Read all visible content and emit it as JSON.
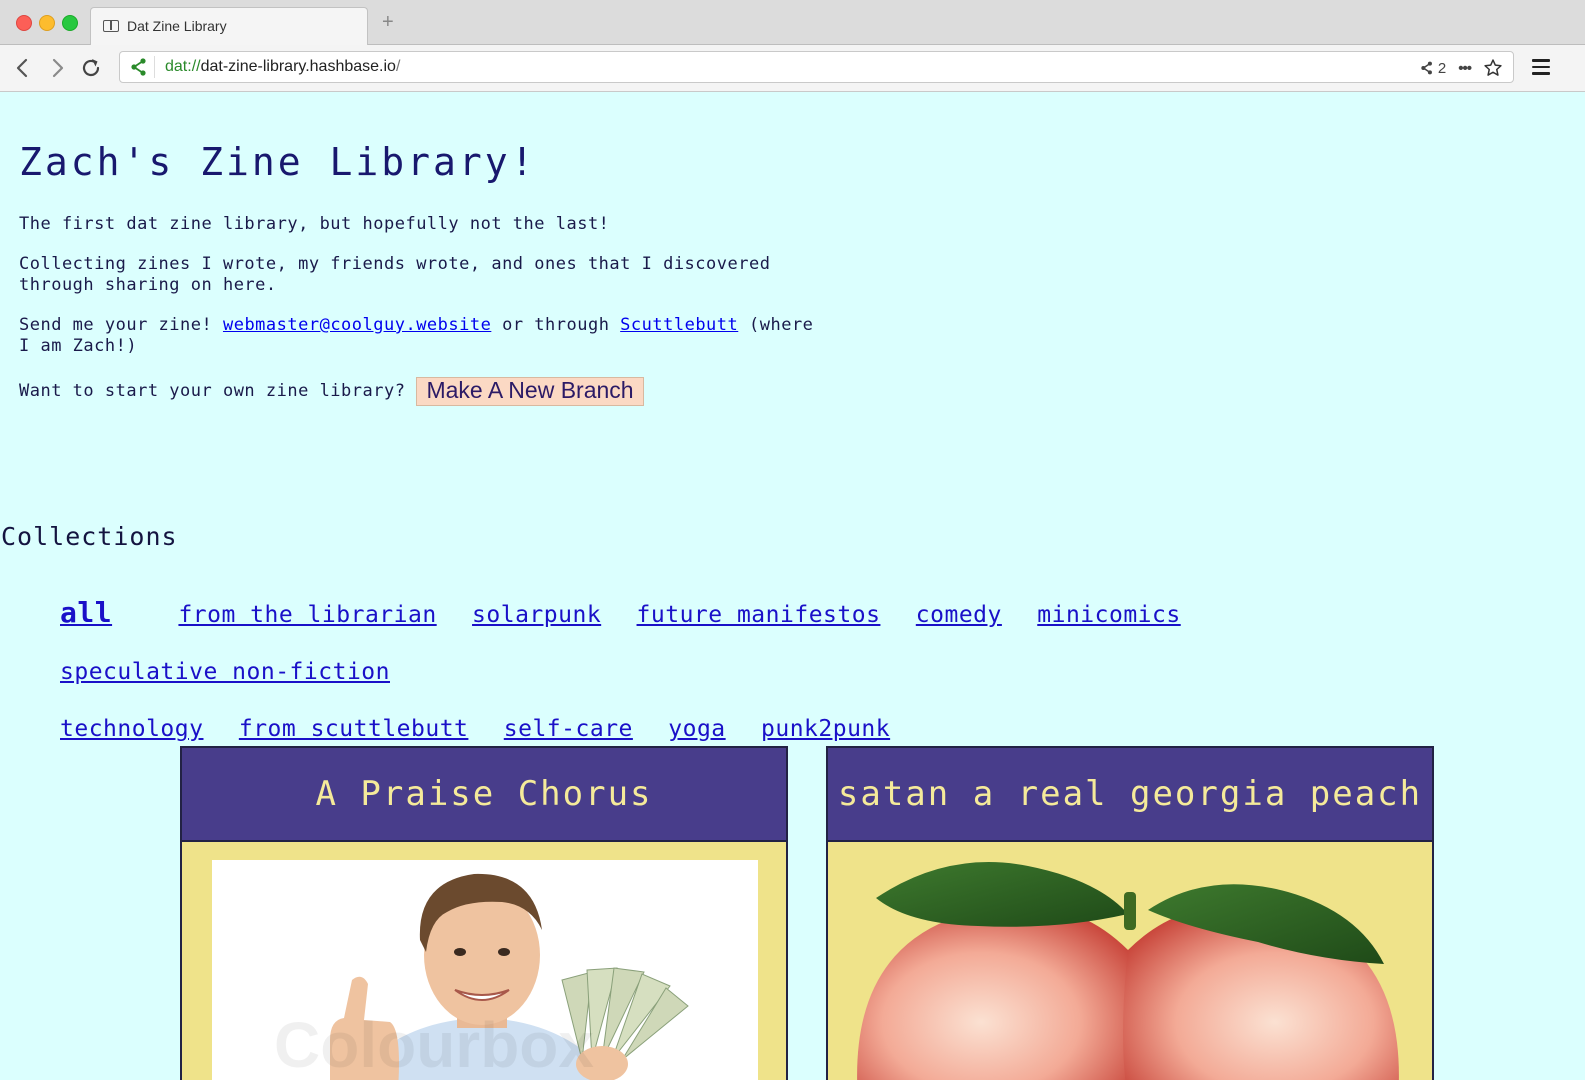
{
  "browser": {
    "tab_title": "Dat Zine Library",
    "new_tab_label": "+",
    "url_scheme": "dat://",
    "url_host": "dat-zine-library.hashbase.io",
    "url_path": "/",
    "peer_count": "2",
    "more_label": "•••"
  },
  "page": {
    "title": "Zach's Zine Library!",
    "intro_1": "The first dat zine library, but hopefully not the last!",
    "intro_2": "Collecting zines I wrote, my friends wrote, and ones that I discovered through sharing on here.",
    "send_prefix": "Send me your zine! ",
    "send_email": "webmaster@coolguy.website",
    "send_middle": " or through ",
    "send_ssb": "Scuttlebutt",
    "send_suffix": " (where I am Zach!)",
    "branch_prompt": "Want to start your own zine library?",
    "branch_button": "Make A New Branch",
    "collections_heading": "Collections",
    "collections": [
      "all",
      "from the librarian",
      "solarpunk",
      "future manifestos",
      "comedy",
      "minicomics",
      "speculative non-fiction",
      "technology",
      "from scuttlebutt",
      "self-care",
      "yoga",
      "punk2punk"
    ],
    "cards": [
      {
        "title": "A Praise Chorus",
        "watermark": "Colourbox"
      },
      {
        "title": "satan a real georgia peach"
      }
    ]
  },
  "colors": {
    "page_bg": "#dbfffe",
    "card_header": "#483d8b",
    "card_body": "#efe38a",
    "card_title": "#f5ea9a",
    "button_bg": "#fbd9c4",
    "link": "#1a10c8"
  }
}
